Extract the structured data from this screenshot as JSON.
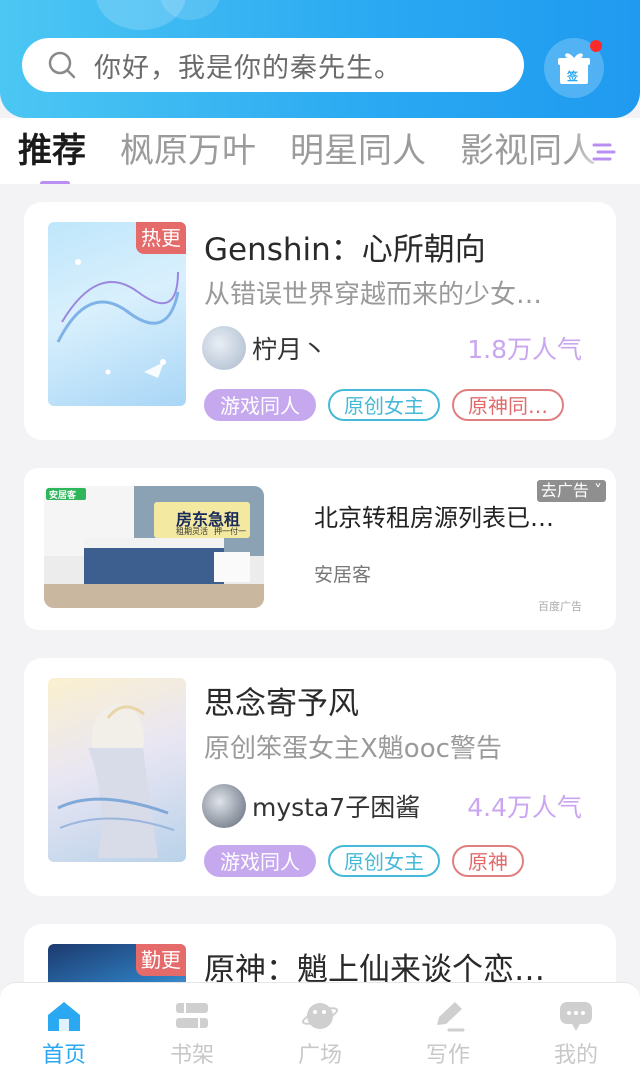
{
  "header": {
    "search_placeholder": "你好，我是你的秦先生。",
    "sign_label": "签"
  },
  "tabs": [
    {
      "label": "推荐",
      "active": true
    },
    {
      "label": "枫原万叶",
      "active": false
    },
    {
      "label": "明星同人",
      "active": false
    },
    {
      "label": "影视同人",
      "active": false
    }
  ],
  "feed": [
    {
      "badge": "热更",
      "title": "Genshin：心所朝向",
      "description": "从错误世界穿越而来的少女…",
      "author": "柠月丶",
      "popularity": "1.8万人气",
      "tags": [
        "游戏同人",
        "原创女主",
        "原神同…"
      ]
    },
    {
      "title": "思念寄予风",
      "description": "原创笨蛋女主X魈ooc警告",
      "author": "mysta7子困酱",
      "popularity": "4.4万人气",
      "tags": [
        "游戏同人",
        "原创女主",
        "原神"
      ]
    },
    {
      "badge": "勤更",
      "title": "原神：魈上仙来谈个恋…"
    }
  ],
  "ad": {
    "title": "北京转租房源列表已…",
    "source": "安居客",
    "close_label": "去广告",
    "footer": "百度广告",
    "image_logo": "安居客",
    "image_headline": "房东急租",
    "image_sub1": "租期灵活",
    "image_sub2": "押一付一"
  },
  "bottom_nav": [
    {
      "label": "首页",
      "icon": "home-icon",
      "active": true
    },
    {
      "label": "书架",
      "icon": "bookshelf-icon",
      "active": false
    },
    {
      "label": "广场",
      "icon": "planet-icon",
      "active": false
    },
    {
      "label": "写作",
      "icon": "pen-icon",
      "active": false
    },
    {
      "label": "我的",
      "icon": "chat-icon",
      "active": false
    }
  ],
  "colors": {
    "accent": "#2aa8f2",
    "tab_underline": "#b98ff2",
    "popularity": "#c9a6ef",
    "badge": "#e56a6a"
  }
}
